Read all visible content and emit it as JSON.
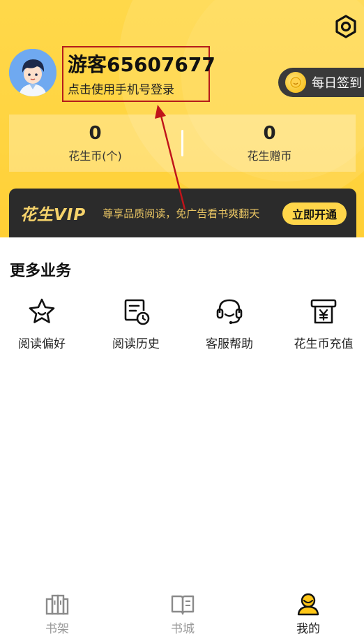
{
  "header": {
    "settings_icon": "gear-icon",
    "username": "游客65607677",
    "login_hint": "点击使用手机号登录",
    "checkin_label": "每日签到",
    "accent": "#ffd84a"
  },
  "coins": {
    "peanut_coins": {
      "value": "0",
      "label": "花生币(个)"
    },
    "gift_coins": {
      "value": "0",
      "label": "花生赠币"
    }
  },
  "vip": {
    "logo": "花生VIP",
    "description": "尊享品质阅读，免广告看书爽翻天",
    "button_label": "立即开通"
  },
  "more_services": {
    "title": "更多业务",
    "items": [
      {
        "label": "阅读偏好",
        "icon": "star-icon"
      },
      {
        "label": "阅读历史",
        "icon": "history-icon"
      },
      {
        "label": "客服帮助",
        "icon": "headset-icon"
      },
      {
        "label": "花生币充值",
        "icon": "recharge-icon"
      }
    ]
  },
  "tabbar": {
    "items": [
      {
        "label": "书架",
        "icon": "bookshelf-icon",
        "active": false
      },
      {
        "label": "书城",
        "icon": "book-icon",
        "active": false
      },
      {
        "label": "我的",
        "icon": "profile-icon",
        "active": true
      }
    ]
  }
}
